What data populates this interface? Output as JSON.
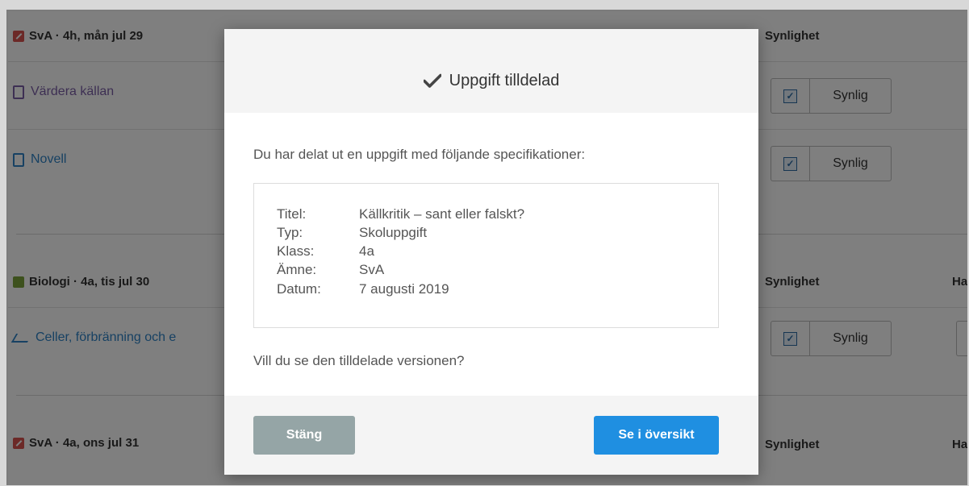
{
  "background": {
    "sections": [
      {
        "title": "SvA · 4h, mån jul 29",
        "visibility_header": "Synlighet",
        "rows": [
          {
            "label": "Värdera källan",
            "visibility": "Synlig"
          },
          {
            "label": "Novell",
            "visibility": "Synlig"
          }
        ]
      },
      {
        "title": "Biologi · 4a, tis jul 30",
        "visibility_header": "Synlighet",
        "extra_header": "Ha",
        "rows": [
          {
            "label": "Celler, förbränning och e",
            "visibility": "Synlig"
          }
        ]
      },
      {
        "title": "SvA · 4a, ons jul 31",
        "visibility_header": "Synlighet",
        "extra_header": "Ha",
        "rows": []
      }
    ]
  },
  "modal": {
    "title": "Uppgift tilldelad",
    "intro": "Du har delat ut en uppgift med följande specifikationer:",
    "specs": [
      {
        "key": "Titel:",
        "value": "Källkritik – sant eller falskt?"
      },
      {
        "key": "Typ:",
        "value": "Skoluppgift"
      },
      {
        "key": "Klass:",
        "value": "4a"
      },
      {
        "key": "Ämne:",
        "value": "SvA"
      },
      {
        "key": "Datum:",
        "value": "7 augusti 2019"
      }
    ],
    "question": "Vill du se den tilldelade versionen?",
    "close_label": "Stäng",
    "overview_label": "Se i översikt"
  },
  "colors": {
    "primary_button": "#1f8fe1",
    "secondary_button": "#95a5a6",
    "overlay": "rgba(0,0,0,0.5)"
  }
}
